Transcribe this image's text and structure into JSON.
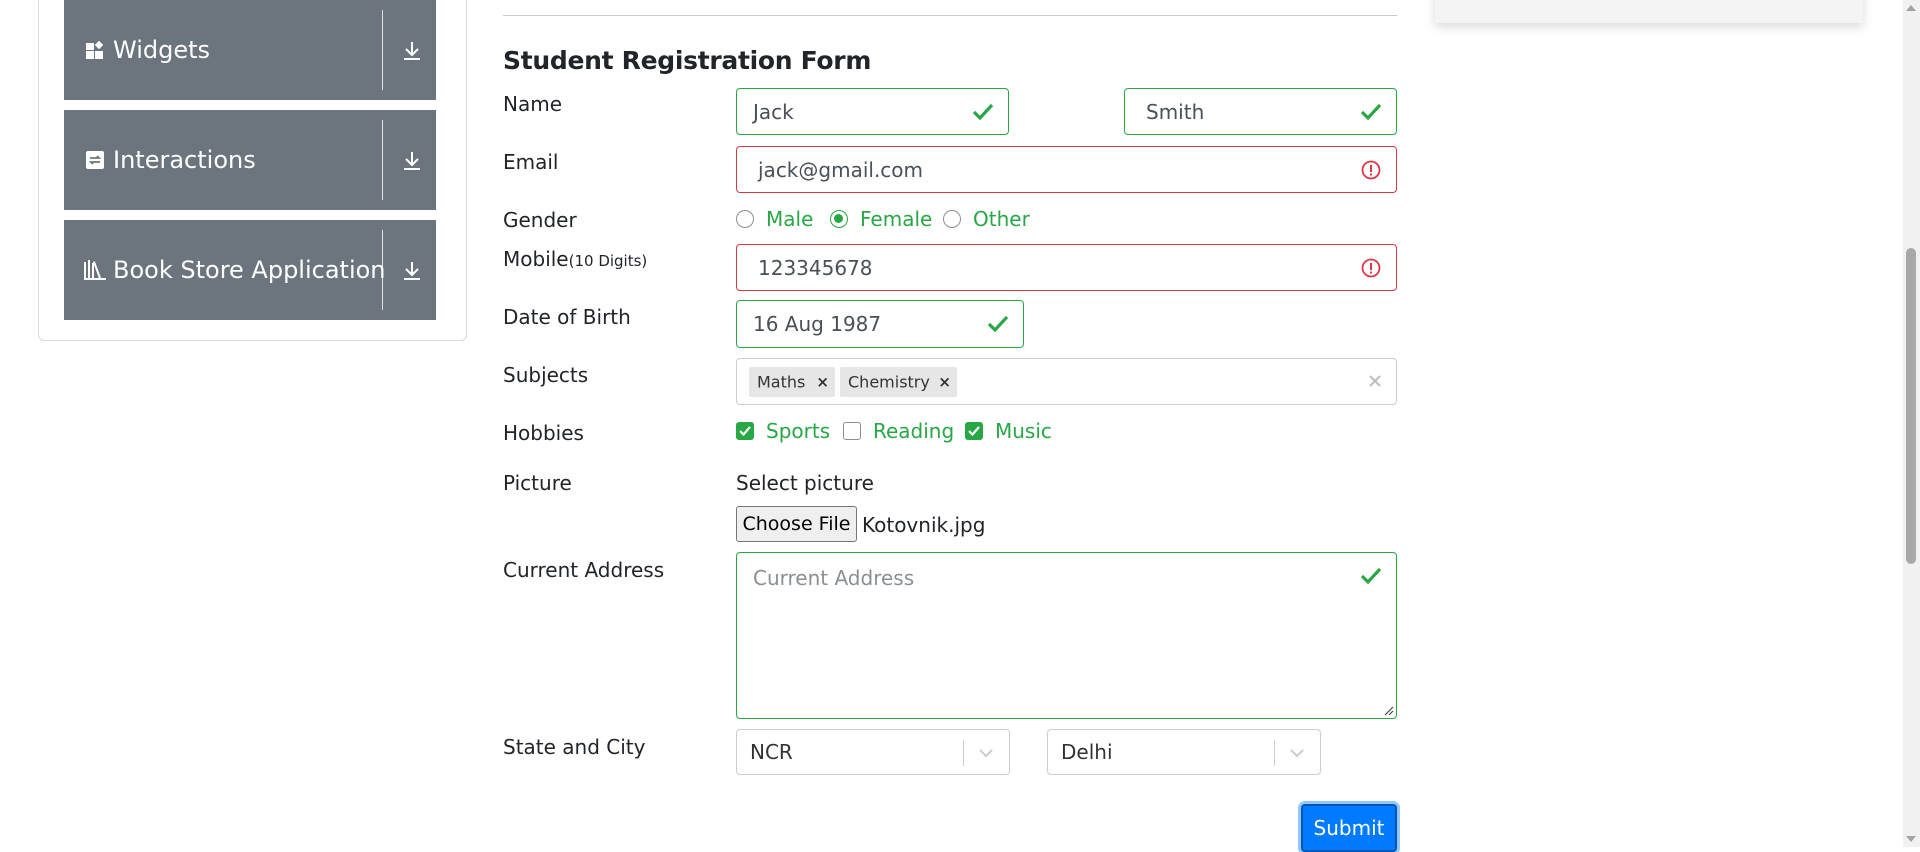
{
  "sidebar": {
    "groups": [
      {
        "label": "Widgets",
        "icon": "widgets-icon"
      },
      {
        "label": "Interactions",
        "icon": "interactions-icon"
      },
      {
        "label": "Book Store Application",
        "icon": "book-store-icon"
      }
    ]
  },
  "form": {
    "title": "Student Registration Form",
    "labels": {
      "name": "Name",
      "email": "Email",
      "gender": "Gender",
      "mobile": "Mobile",
      "mobile_hint": "(10 Digits)",
      "dob": "Date of Birth",
      "subjects": "Subjects",
      "hobbies": "Hobbies",
      "picture": "Picture",
      "address": "Current Address",
      "state_city": "State and City"
    },
    "first_name": "Jack",
    "last_name": "Smith",
    "email": "jack@gmail.com",
    "gender_options": [
      {
        "label": "Male",
        "selected": false
      },
      {
        "label": "Female",
        "selected": true
      },
      {
        "label": "Other",
        "selected": false
      }
    ],
    "mobile": "123345678",
    "dob": "16 Aug 1987",
    "subjects": [
      "Maths",
      "Chemistry"
    ],
    "hobbies": [
      {
        "label": "Sports",
        "checked": true
      },
      {
        "label": "Reading",
        "checked": false
      },
      {
        "label": "Music",
        "checked": true
      }
    ],
    "picture_prompt": "Select picture",
    "choose_file_label": "Choose File",
    "file_name": "Kotovnik.jpg",
    "address_placeholder": "Current Address",
    "state": "NCR",
    "city": "Delhi",
    "submit_label": "Submit"
  },
  "colors": {
    "valid": "#28a745",
    "invalid": "#dc3545",
    "primary": "#007bff",
    "sidebar": "#6c757d"
  }
}
